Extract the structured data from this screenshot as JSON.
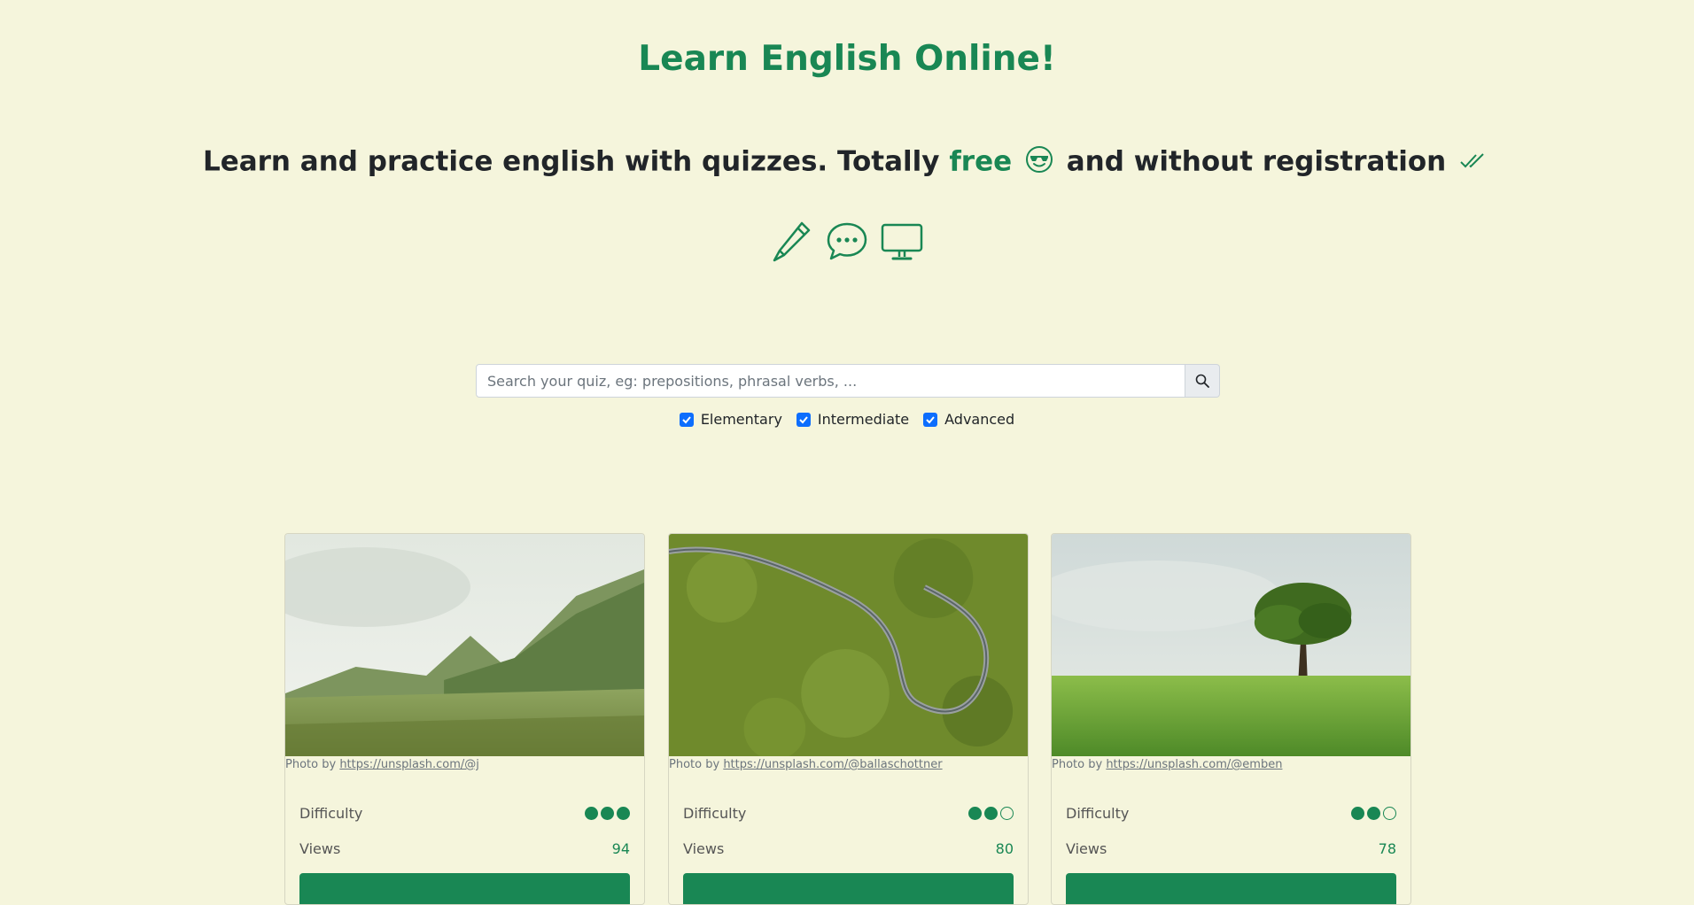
{
  "header": {
    "title": "Learn English Online!",
    "tagline_before": "Learn and practice english with quizzes. Totally",
    "tagline_free": "free",
    "tagline_after": "and without registration",
    "accent_color": "#198754"
  },
  "icons": [
    "pencil-icon",
    "chat-icon",
    "monitor-icon",
    "smiling-face-with-sunglasses-icon",
    "double-check-icon",
    "search-icon"
  ],
  "search": {
    "placeholder": "Search your quiz, eg: prepositions, phrasal verbs, ...",
    "value": ""
  },
  "filters": [
    {
      "label": "Elementary",
      "checked": true
    },
    {
      "label": "Intermediate",
      "checked": true
    },
    {
      "label": "Advanced",
      "checked": true
    }
  ],
  "cards": [
    {
      "photo_prefix": "Photo by",
      "photo_link": "https://unsplash.com/@j",
      "difficulty_label": "Difficulty",
      "difficulty_level": 3,
      "difficulty_max": 3,
      "views_label": "Views",
      "views": "94"
    },
    {
      "photo_prefix": "Photo by",
      "photo_link": "https://unsplash.com/@ballaschottner",
      "difficulty_label": "Difficulty",
      "difficulty_level": 2,
      "difficulty_max": 3,
      "views_label": "Views",
      "views": "80"
    },
    {
      "photo_prefix": "Photo by",
      "photo_link": "https://unsplash.com/@emben",
      "difficulty_label": "Difficulty",
      "difficulty_level": 2,
      "difficulty_max": 3,
      "views_label": "Views",
      "views": "78"
    }
  ]
}
